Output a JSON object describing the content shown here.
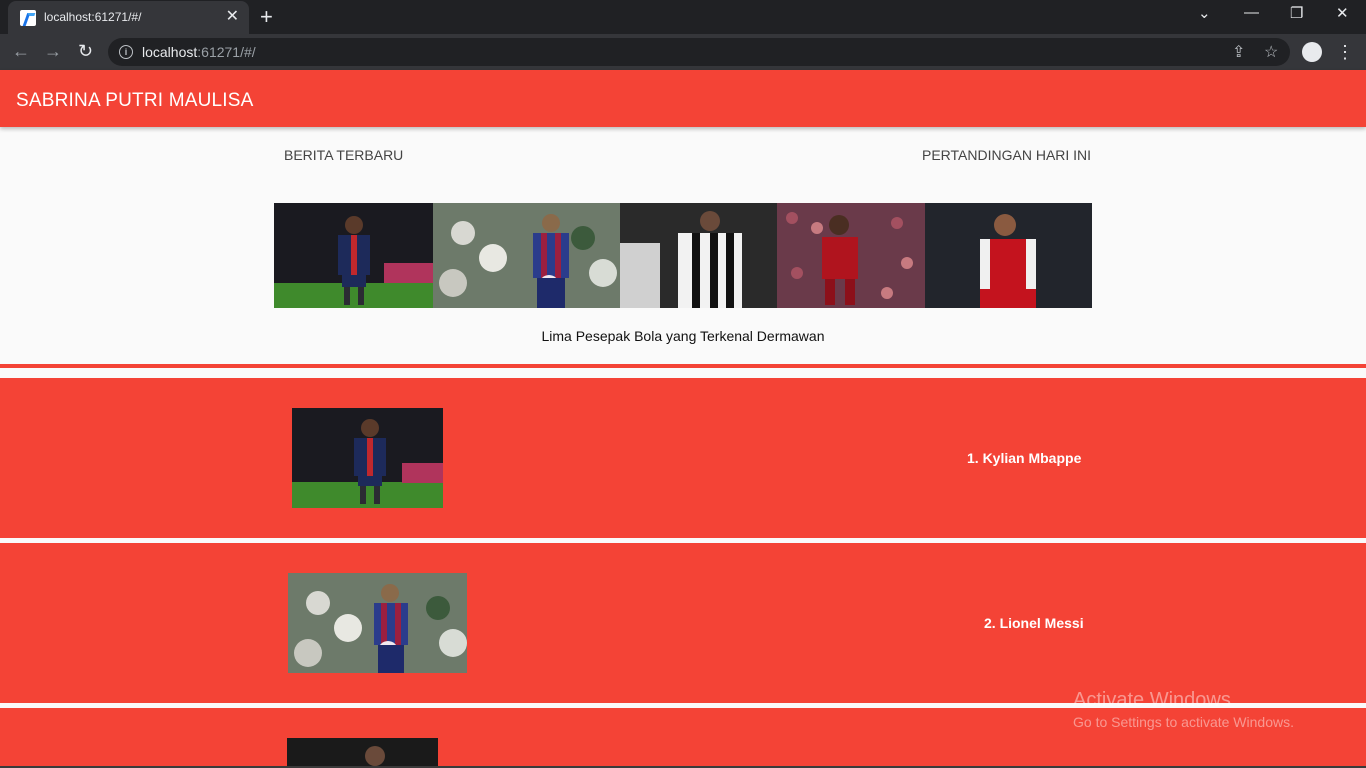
{
  "browser": {
    "tab_title": "localhost:61271/#/",
    "url_host": "localhost",
    "url_rest": ":61271/#/"
  },
  "app": {
    "title": "SABRINA PUTRI MAULISA",
    "nav": {
      "news": "BERITA TERBARU",
      "matches": "PERTANDINGAN HARI INI"
    },
    "banner_caption": "Lima Pesepak Bola yang Terkenal Dermawan",
    "banner_images": [
      "mbappe-photo",
      "messi-photo",
      "ronaldo-photo",
      "salah-photo",
      "ozil-photo"
    ],
    "players": [
      {
        "label": "1. Kylian Mbappe"
      },
      {
        "label": "2. Lionel Messi"
      }
    ]
  },
  "os": {
    "watermark_title": "Activate Windows",
    "watermark_sub": "Go to Settings to activate Windows."
  },
  "colors": {
    "accent": "#f44336",
    "chrome_dark": "#202124",
    "chrome_mid": "#35363a"
  }
}
